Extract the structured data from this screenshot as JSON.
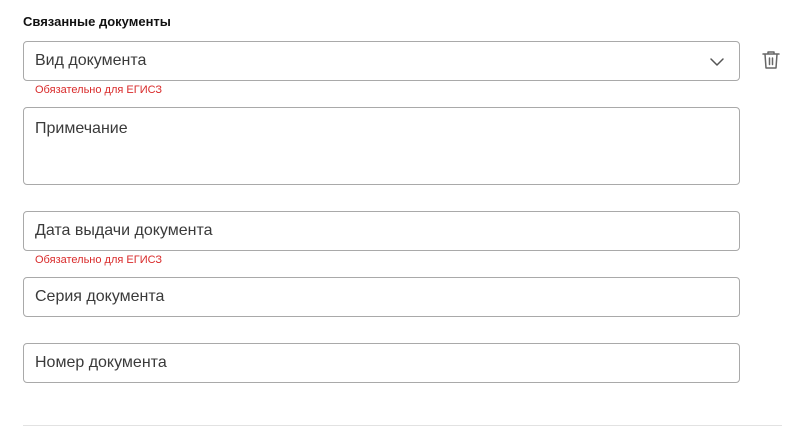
{
  "section": {
    "title": "Связанные документы"
  },
  "fields": {
    "doc_type": {
      "placeholder": "Вид документа"
    },
    "note": {
      "placeholder": "Примечание"
    },
    "issue_date": {
      "placeholder": "Дата выдачи документа"
    },
    "series": {
      "placeholder": "Серия документа"
    },
    "number": {
      "placeholder": "Номер документа"
    }
  },
  "errors": {
    "doc_type_required": "Обязательно для ЕГИСЗ",
    "issue_date_required": "Обязательно для ЕГИСЗ"
  },
  "icons": {
    "dropdown": "chevron-down-icon",
    "delete": "trash-icon"
  },
  "colors": {
    "error": "#d92b2b",
    "border": "#a9a9a9",
    "text": "#3a3a3a"
  }
}
